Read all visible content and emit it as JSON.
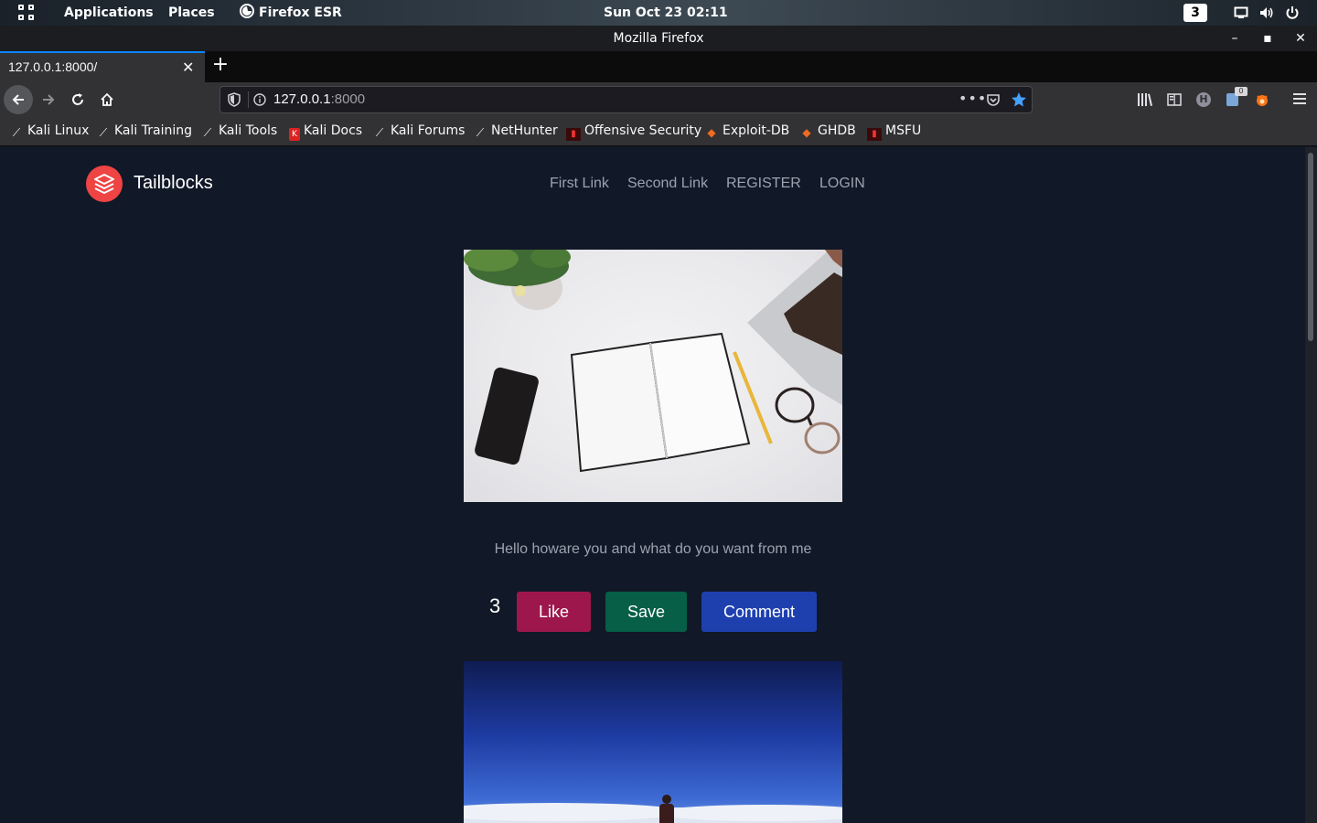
{
  "topbar": {
    "applications": "Applications",
    "places": "Places",
    "firefox": "Firefox ESR",
    "clock": "Sun Oct 23  02:11",
    "workspace": "3"
  },
  "window": {
    "title": "Mozilla Firefox"
  },
  "tab": {
    "label": "127.0.0.1:8000/"
  },
  "urlbar": {
    "host": "127.0.0.1",
    "port": ":8000"
  },
  "toolbar": {
    "extension_badge": "0"
  },
  "bookmarks": [
    {
      "label": "Kali Linux",
      "icon": "kali-icon"
    },
    {
      "label": "Kali Training",
      "icon": "kali-icon"
    },
    {
      "label": "Kali Tools",
      "icon": "kali-icon"
    },
    {
      "label": "Kali Docs",
      "icon": "kali-docs-icon"
    },
    {
      "label": "Kali Forums",
      "icon": "kali-icon"
    },
    {
      "label": "NetHunter",
      "icon": "kali-icon"
    },
    {
      "label": "Offensive Security",
      "icon": "offsec-icon"
    },
    {
      "label": "Exploit-DB",
      "icon": "exploitdb-icon"
    },
    {
      "label": "GHDB",
      "icon": "exploitdb-icon"
    },
    {
      "label": "MSFU",
      "icon": "offsec-icon"
    }
  ],
  "site": {
    "brand": "Tailblocks",
    "nav": [
      "First Link",
      "Second Link",
      "REGISTER",
      "LOGIN"
    ],
    "post": {
      "caption": "Hello howare you and what do you want from me",
      "likes": "3",
      "like_label": "Like",
      "save_label": "Save",
      "comment_label": "Comment"
    }
  },
  "colors": {
    "page_bg": "#111827",
    "logo": "#ef4444",
    "like": "#9d174d",
    "save": "#065f46",
    "comment": "#1e40af"
  }
}
